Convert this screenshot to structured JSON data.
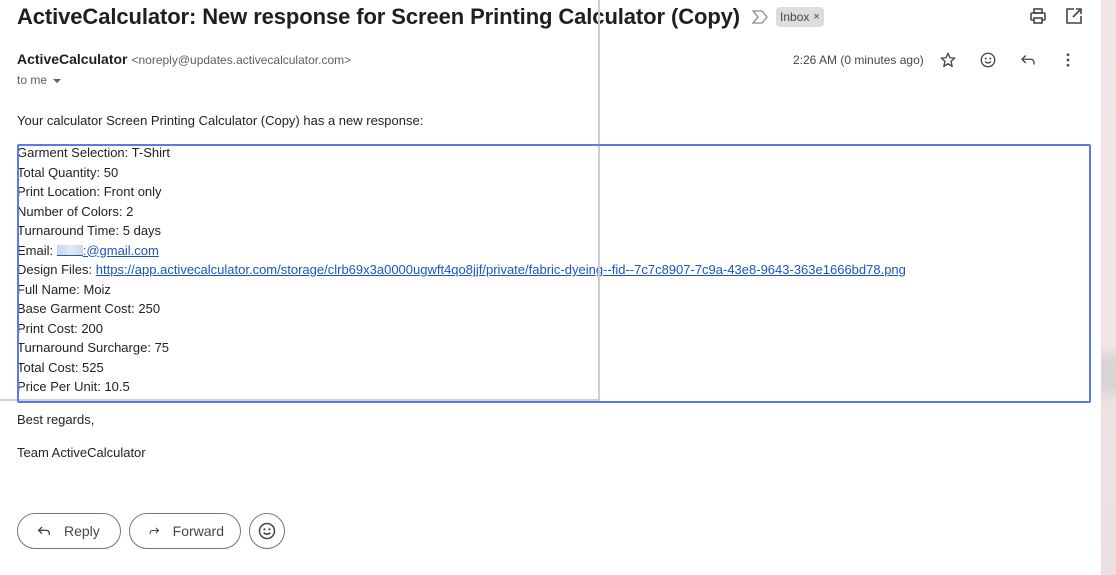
{
  "header": {
    "subject": "ActiveCalculator: New response for Screen Printing Calculator (Copy)",
    "importance_icon": "importance-marker-icon",
    "label": "Inbox",
    "label_remove": "×",
    "print_icon": "print-icon",
    "open_new_window_icon": "open-in-new-window-icon"
  },
  "sender": {
    "name": "ActiveCalculator",
    "email": "<noreply@updates.activecalculator.com>",
    "recipient": "to me",
    "timestamp": "2:26 AM (0 minutes ago)",
    "icons": [
      "star-icon",
      "emoji-reaction-icon",
      "reply-icon",
      "more-options-icon"
    ]
  },
  "body": {
    "intro": "Your calculator Screen Printing Calculator (Copy) has a new response:",
    "fields": [
      {
        "label": "Garment Selection",
        "value": "T-Shirt"
      },
      {
        "label": "Total Quantity",
        "value": "50"
      },
      {
        "label": "Print Location",
        "value": "Front only"
      },
      {
        "label": "Number of Colors",
        "value": "2"
      },
      {
        "label": "Turnaround Time",
        "value": "5 days"
      },
      {
        "label": "Email",
        "value": ":@gmail.com",
        "link": true,
        "redacted": true
      },
      {
        "label": "Design Files",
        "value": "https://app.activecalculator.com/storage/clrb69x3a0000ugwft4qo8jjf/private/fabric-dyeing--fid--7c7c8907-7c9a-43e8-9643-363e1666bd78.png",
        "link": true
      },
      {
        "label": "Full Name",
        "value": "Moiz"
      },
      {
        "label": "Base Garment Cost",
        "value": "250"
      },
      {
        "label": "Print Cost",
        "value": "200"
      },
      {
        "label": "Turnaround Surcharge",
        "value": "75"
      },
      {
        "label": "Total Cost",
        "value": "525"
      },
      {
        "label": "Price Per Unit",
        "value": "10.5"
      }
    ],
    "signoff": "Best regards,",
    "team": "Team ActiveCalculator"
  },
  "actions": {
    "reply_label": "Reply",
    "forward_label": "Forward"
  },
  "colors": {
    "highlight": "#5b78ee",
    "link": "#1a55c7",
    "label_chip_bg": "#dddddd"
  }
}
